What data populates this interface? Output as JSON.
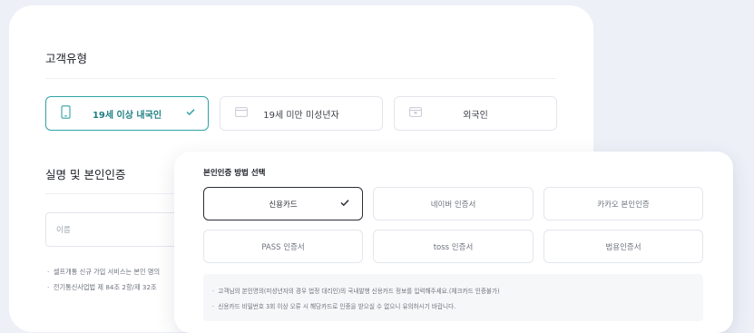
{
  "back_card": {
    "customer_type_title": "고객유형",
    "customer_options": [
      {
        "label": "19세 이상 내국인",
        "selected": true
      },
      {
        "label": "19세 미만 미성년자",
        "selected": false
      },
      {
        "label": "외국인",
        "selected": false
      }
    ],
    "verify_title": "실명 및 본인인증",
    "name_placeholder": "이름",
    "notes": [
      "셀프개통 신규 가입 서비스는 본인 명의",
      "전기통신사업법 제 84조 2항/제 32조"
    ]
  },
  "front_card": {
    "title": "본인인증 방법 선택",
    "methods": [
      {
        "label": "신용카드",
        "selected": true
      },
      {
        "label": "네이버 인증서",
        "selected": false
      },
      {
        "label": "카카오 본인인증",
        "selected": false
      },
      {
        "label": "PASS 인증서",
        "selected": false
      },
      {
        "label": "toss 인증서",
        "selected": false
      },
      {
        "label": "범용인증서",
        "selected": false
      }
    ],
    "notes": [
      "고객님의 본인명의(미성년자의 경우 법정 대리인)의 국내발행 신용카드 정보를 입력해주세요.(체크카드 인증불가)",
      "신용카드 비밀번호 3회 이상 오류 시 해당카드로 인증을 받으실 수 없으니 유의하시기 바랍니다."
    ]
  },
  "colors": {
    "accent": "#2fa3a5",
    "background": "#edf0f7",
    "card": "#ffffff"
  }
}
